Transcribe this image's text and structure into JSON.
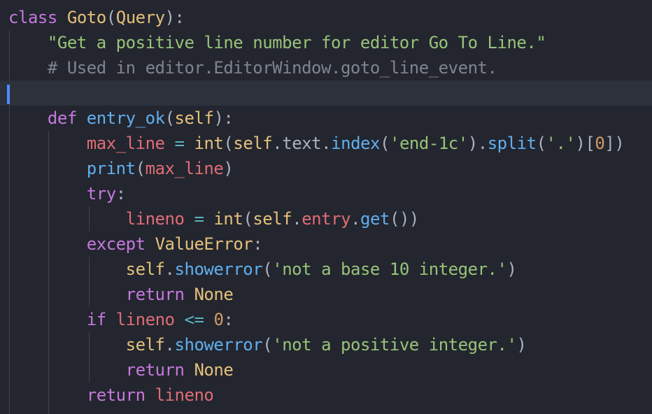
{
  "editor": {
    "theme_colors": {
      "background": "#23262f",
      "current_line": "#2c313c",
      "caret": "#528bff",
      "indent_guide": "#3e4451",
      "keyword": "#c678dd",
      "class_name": "#e5c07b",
      "string": "#98c379",
      "comment": "#7f848e",
      "function": "#61afef",
      "self": "#e5c07b",
      "variable": "#e06c75",
      "number": "#d19a66",
      "operator": "#56b6c2",
      "text": "#abb2bf"
    },
    "current_line_index": 3,
    "lines": [
      [
        [
          "tok-kw",
          "class"
        ],
        [
          "tok-punc",
          " "
        ],
        [
          "tok-cls",
          "Goto"
        ],
        [
          "tok-punc",
          "("
        ],
        [
          "tok-cls",
          "Query"
        ],
        [
          "tok-punc",
          "):"
        ]
      ],
      [
        [
          "tok-punc",
          "    "
        ],
        [
          "tok-str",
          "\"Get a positive line number for editor Go To Line.\""
        ]
      ],
      [
        [
          "tok-punc",
          "    "
        ],
        [
          "tok-cmt",
          "# Used in editor.EditorWindow.goto_line_event."
        ]
      ],
      [],
      [
        [
          "tok-punc",
          "    "
        ],
        [
          "tok-kw",
          "def"
        ],
        [
          "tok-punc",
          " "
        ],
        [
          "tok-fn",
          "entry_ok"
        ],
        [
          "tok-punc",
          "("
        ],
        [
          "tok-self",
          "self"
        ],
        [
          "tok-punc",
          "):"
        ]
      ],
      [
        [
          "tok-punc",
          "        "
        ],
        [
          "tok-var",
          "max_line"
        ],
        [
          "tok-punc",
          " "
        ],
        [
          "tok-op",
          "="
        ],
        [
          "tok-punc",
          " "
        ],
        [
          "tok-bi",
          "int"
        ],
        [
          "tok-punc",
          "("
        ],
        [
          "tok-self",
          "self"
        ],
        [
          "tok-punc",
          "."
        ],
        [
          "tok-punc",
          "text"
        ],
        [
          "tok-punc",
          "."
        ],
        [
          "tok-fn",
          "index"
        ],
        [
          "tok-punc",
          "("
        ],
        [
          "tok-str",
          "'end-1c'"
        ],
        [
          "tok-punc",
          ")."
        ],
        [
          "tok-fn",
          "split"
        ],
        [
          "tok-punc",
          "("
        ],
        [
          "tok-str",
          "'.'"
        ],
        [
          "tok-punc",
          ")["
        ],
        [
          "tok-num",
          "0"
        ],
        [
          "tok-punc",
          "])"
        ]
      ],
      [
        [
          "tok-punc",
          "        "
        ],
        [
          "tok-fn",
          "print"
        ],
        [
          "tok-punc",
          "("
        ],
        [
          "tok-var",
          "max_line"
        ],
        [
          "tok-punc",
          ")"
        ]
      ],
      [
        [
          "tok-punc",
          "        "
        ],
        [
          "tok-kw",
          "try"
        ],
        [
          "tok-punc",
          ":"
        ]
      ],
      [
        [
          "tok-punc",
          "            "
        ],
        [
          "tok-var",
          "lineno"
        ],
        [
          "tok-punc",
          " "
        ],
        [
          "tok-op",
          "="
        ],
        [
          "tok-punc",
          " "
        ],
        [
          "tok-bi",
          "int"
        ],
        [
          "tok-punc",
          "("
        ],
        [
          "tok-self",
          "self"
        ],
        [
          "tok-punc",
          "."
        ],
        [
          "tok-var",
          "entry"
        ],
        [
          "tok-punc",
          "."
        ],
        [
          "tok-fn",
          "get"
        ],
        [
          "tok-punc",
          "())"
        ]
      ],
      [
        [
          "tok-punc",
          "        "
        ],
        [
          "tok-kw",
          "except"
        ],
        [
          "tok-punc",
          " "
        ],
        [
          "tok-cls",
          "ValueError"
        ],
        [
          "tok-punc",
          ":"
        ]
      ],
      [
        [
          "tok-punc",
          "            "
        ],
        [
          "tok-self",
          "self"
        ],
        [
          "tok-punc",
          "."
        ],
        [
          "tok-fn",
          "showerror"
        ],
        [
          "tok-punc",
          "("
        ],
        [
          "tok-str",
          "'not a base 10 integer.'"
        ],
        [
          "tok-punc",
          ")"
        ]
      ],
      [
        [
          "tok-punc",
          "            "
        ],
        [
          "tok-kw",
          "return"
        ],
        [
          "tok-punc",
          " "
        ],
        [
          "tok-const",
          "None"
        ]
      ],
      [
        [
          "tok-punc",
          "        "
        ],
        [
          "tok-kw",
          "if"
        ],
        [
          "tok-punc",
          " "
        ],
        [
          "tok-var",
          "lineno"
        ],
        [
          "tok-punc",
          " "
        ],
        [
          "tok-op",
          "<="
        ],
        [
          "tok-punc",
          " "
        ],
        [
          "tok-num",
          "0"
        ],
        [
          "tok-punc",
          ":"
        ]
      ],
      [
        [
          "tok-punc",
          "            "
        ],
        [
          "tok-self",
          "self"
        ],
        [
          "tok-punc",
          "."
        ],
        [
          "tok-fn",
          "showerror"
        ],
        [
          "tok-punc",
          "("
        ],
        [
          "tok-str",
          "'not a positive integer.'"
        ],
        [
          "tok-punc",
          ")"
        ]
      ],
      [
        [
          "tok-punc",
          "            "
        ],
        [
          "tok-kw",
          "return"
        ],
        [
          "tok-punc",
          " "
        ],
        [
          "tok-const",
          "None"
        ]
      ],
      [
        [
          "tok-punc",
          "        "
        ],
        [
          "tok-kw",
          "return"
        ],
        [
          "tok-punc",
          " "
        ],
        [
          "tok-var",
          "lineno"
        ]
      ]
    ]
  }
}
